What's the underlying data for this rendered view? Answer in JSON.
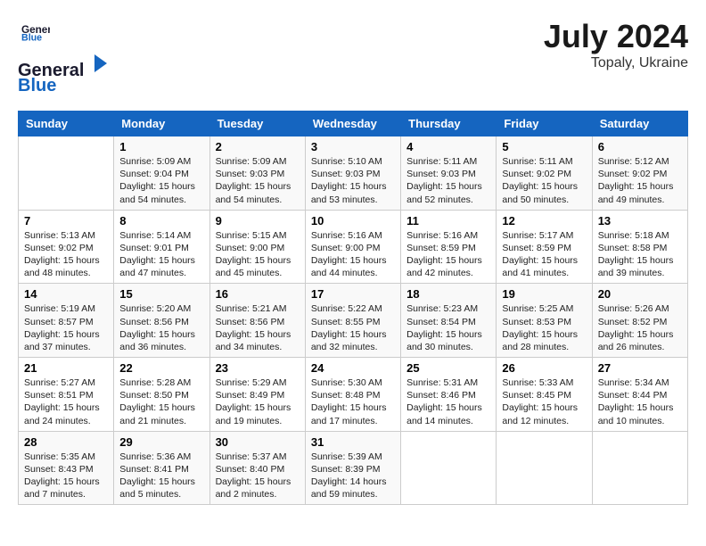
{
  "header": {
    "logo_line1": "General",
    "logo_line2": "Blue",
    "month_year": "July 2024",
    "location": "Topaly, Ukraine"
  },
  "weekdays": [
    "Sunday",
    "Monday",
    "Tuesday",
    "Wednesday",
    "Thursday",
    "Friday",
    "Saturday"
  ],
  "weeks": [
    [
      {
        "day": "",
        "content": ""
      },
      {
        "day": "1",
        "content": "Sunrise: 5:09 AM\nSunset: 9:04 PM\nDaylight: 15 hours\nand 54 minutes."
      },
      {
        "day": "2",
        "content": "Sunrise: 5:09 AM\nSunset: 9:03 PM\nDaylight: 15 hours\nand 54 minutes."
      },
      {
        "day": "3",
        "content": "Sunrise: 5:10 AM\nSunset: 9:03 PM\nDaylight: 15 hours\nand 53 minutes."
      },
      {
        "day": "4",
        "content": "Sunrise: 5:11 AM\nSunset: 9:03 PM\nDaylight: 15 hours\nand 52 minutes."
      },
      {
        "day": "5",
        "content": "Sunrise: 5:11 AM\nSunset: 9:02 PM\nDaylight: 15 hours\nand 50 minutes."
      },
      {
        "day": "6",
        "content": "Sunrise: 5:12 AM\nSunset: 9:02 PM\nDaylight: 15 hours\nand 49 minutes."
      }
    ],
    [
      {
        "day": "7",
        "content": "Sunrise: 5:13 AM\nSunset: 9:02 PM\nDaylight: 15 hours\nand 48 minutes."
      },
      {
        "day": "8",
        "content": "Sunrise: 5:14 AM\nSunset: 9:01 PM\nDaylight: 15 hours\nand 47 minutes."
      },
      {
        "day": "9",
        "content": "Sunrise: 5:15 AM\nSunset: 9:00 PM\nDaylight: 15 hours\nand 45 minutes."
      },
      {
        "day": "10",
        "content": "Sunrise: 5:16 AM\nSunset: 9:00 PM\nDaylight: 15 hours\nand 44 minutes."
      },
      {
        "day": "11",
        "content": "Sunrise: 5:16 AM\nSunset: 8:59 PM\nDaylight: 15 hours\nand 42 minutes."
      },
      {
        "day": "12",
        "content": "Sunrise: 5:17 AM\nSunset: 8:59 PM\nDaylight: 15 hours\nand 41 minutes."
      },
      {
        "day": "13",
        "content": "Sunrise: 5:18 AM\nSunset: 8:58 PM\nDaylight: 15 hours\nand 39 minutes."
      }
    ],
    [
      {
        "day": "14",
        "content": "Sunrise: 5:19 AM\nSunset: 8:57 PM\nDaylight: 15 hours\nand 37 minutes."
      },
      {
        "day": "15",
        "content": "Sunrise: 5:20 AM\nSunset: 8:56 PM\nDaylight: 15 hours\nand 36 minutes."
      },
      {
        "day": "16",
        "content": "Sunrise: 5:21 AM\nSunset: 8:56 PM\nDaylight: 15 hours\nand 34 minutes."
      },
      {
        "day": "17",
        "content": "Sunrise: 5:22 AM\nSunset: 8:55 PM\nDaylight: 15 hours\nand 32 minutes."
      },
      {
        "day": "18",
        "content": "Sunrise: 5:23 AM\nSunset: 8:54 PM\nDaylight: 15 hours\nand 30 minutes."
      },
      {
        "day": "19",
        "content": "Sunrise: 5:25 AM\nSunset: 8:53 PM\nDaylight: 15 hours\nand 28 minutes."
      },
      {
        "day": "20",
        "content": "Sunrise: 5:26 AM\nSunset: 8:52 PM\nDaylight: 15 hours\nand 26 minutes."
      }
    ],
    [
      {
        "day": "21",
        "content": "Sunrise: 5:27 AM\nSunset: 8:51 PM\nDaylight: 15 hours\nand 24 minutes."
      },
      {
        "day": "22",
        "content": "Sunrise: 5:28 AM\nSunset: 8:50 PM\nDaylight: 15 hours\nand 21 minutes."
      },
      {
        "day": "23",
        "content": "Sunrise: 5:29 AM\nSunset: 8:49 PM\nDaylight: 15 hours\nand 19 minutes."
      },
      {
        "day": "24",
        "content": "Sunrise: 5:30 AM\nSunset: 8:48 PM\nDaylight: 15 hours\nand 17 minutes."
      },
      {
        "day": "25",
        "content": "Sunrise: 5:31 AM\nSunset: 8:46 PM\nDaylight: 15 hours\nand 14 minutes."
      },
      {
        "day": "26",
        "content": "Sunrise: 5:33 AM\nSunset: 8:45 PM\nDaylight: 15 hours\nand 12 minutes."
      },
      {
        "day": "27",
        "content": "Sunrise: 5:34 AM\nSunset: 8:44 PM\nDaylight: 15 hours\nand 10 minutes."
      }
    ],
    [
      {
        "day": "28",
        "content": "Sunrise: 5:35 AM\nSunset: 8:43 PM\nDaylight: 15 hours\nand 7 minutes."
      },
      {
        "day": "29",
        "content": "Sunrise: 5:36 AM\nSunset: 8:41 PM\nDaylight: 15 hours\nand 5 minutes."
      },
      {
        "day": "30",
        "content": "Sunrise: 5:37 AM\nSunset: 8:40 PM\nDaylight: 15 hours\nand 2 minutes."
      },
      {
        "day": "31",
        "content": "Sunrise: 5:39 AM\nSunset: 8:39 PM\nDaylight: 14 hours\nand 59 minutes."
      },
      {
        "day": "",
        "content": ""
      },
      {
        "day": "",
        "content": ""
      },
      {
        "day": "",
        "content": ""
      }
    ]
  ]
}
